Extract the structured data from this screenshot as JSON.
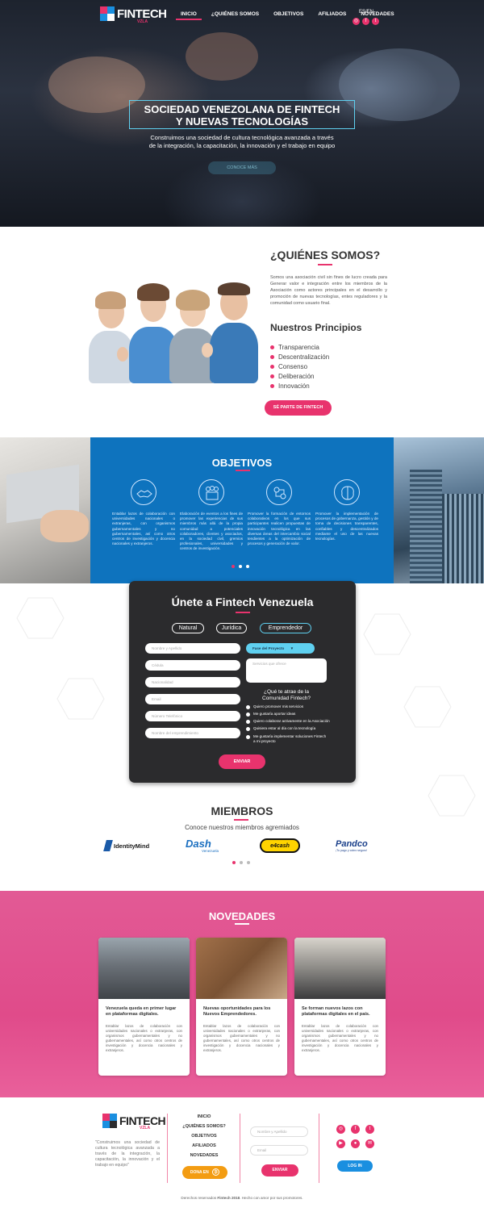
{
  "colors": {
    "accent": "#e8336d",
    "blue": "#0e73be",
    "cyan": "#5fd0f0",
    "dark": "#2b2b2d",
    "orange": "#f39c12",
    "login_blue": "#1a8fe0"
  },
  "brand": {
    "name": "FINTECH",
    "tag": "VZLA"
  },
  "nav": {
    "items": [
      "INICIO",
      "¿QUIÉNES SOMOS",
      "OBJETIVOS",
      "AFILIADOS",
      "NOVEDADES"
    ],
    "active": "INICIO",
    "lang": "ES/EN",
    "social": [
      "instagram-icon",
      "facebook-icon",
      "twitter-icon"
    ]
  },
  "hero": {
    "title_line1": "SOCIEDAD VENEZOLANA DE FINTECH",
    "title_line2": "Y NUEVAS TECNOLOGÍAS",
    "subtitle_line1": "Construimos una sociedad de cultura tecnológica avanzada a través",
    "subtitle_line2": "de la integración, la capacitación, la innovación y el trabajo en equipo",
    "button": "CONOCE MÁS"
  },
  "who": {
    "title": "¿QUIÉNES SOMOS?",
    "text": "Somos una asociación civil sin fines de lucro creada para Generar valor e integración entre los miembros de la Asociación como actores principales en el desarrollo y promoción de nuevas tecnologías, entes reguladores y la comunidad como usuario final.",
    "principles_title": "Nuestros Principios",
    "principles": [
      "Transparencia",
      "Descentralización",
      "Consenso",
      "Deliberación",
      "Innovación"
    ],
    "button": "SÉ PARTE DE FINTECH"
  },
  "objetivos": {
    "title": "OBJETIVOS",
    "items": [
      {
        "icon": "handshake-icon",
        "text": "Entablar lazos de colaboración con universidades nacionales o extranjeras, con organismos gubernamentales y no gubernamentales, así como otros centros de investigación y docencia nacionales y extranjeros."
      },
      {
        "icon": "people-icon",
        "text": "Elaboración de eventos a los fines de promover las experiencias de sus miembros más allá de la propia comunidad a potenciales colaboradores, clientes y asociados, en la sociedad civil, gremios profesionales, universidades y centros de investigación."
      },
      {
        "icon": "network-icon",
        "text": "Promover la formación de entornos colaborativos en los que sus participantes realicen propuestas de innovación tecnológica en las diversas áreas del intercambio social tendientes a la optimización de procesos y generación de valor."
      },
      {
        "icon": "brain-icon",
        "text": "Promover la implementación de procesos de gobernanza, gestión y de toma de decisiones transparentes, confiables y descentralizados mediante el uso de las nuevas tecnologías."
      }
    ]
  },
  "form": {
    "title": "Únete a Fintech Venezuela",
    "tabs": [
      "Natural",
      "Jurídica",
      "Emprendedor"
    ],
    "selected_tab": "Emprendedor",
    "fields": [
      "Nombre y Apellido",
      "Cédula",
      "Nacionalidad",
      "Email",
      "Número Telefónico",
      "Nombre del emprendimiento"
    ],
    "phase_select": "Fase del Proyecto",
    "services_placeholder": "Servicios que ofrece",
    "question_line1": "¿Qué te atrae de la",
    "question_line2": "Comunidad Fintech?",
    "options": [
      {
        "l1": "Quiero promover mis servicios",
        "l2": ""
      },
      {
        "l1": "Me gustaría aportar ideas",
        "l2": ""
      },
      {
        "l1": "Quiero colaborar activamente en la Asociación",
        "l2": ""
      },
      {
        "l1": "Quisiera estar al día con la tecnología",
        "l2": ""
      },
      {
        "l1": "Me gustaría implementar soluciones Fintech",
        "l2": "a mi proyecto"
      }
    ],
    "submit": "ENVIAR"
  },
  "members": {
    "title": "MIEMBROS",
    "subtitle": "Conoce nuestros miembros agremiados",
    "logos": [
      {
        "name": "IdentityMind"
      },
      {
        "name": "Dash",
        "sub": "Venezuela"
      },
      {
        "name": "e4cash"
      },
      {
        "name": "Pandco",
        "sub": "¡Tu pago y cobro seguro!"
      }
    ]
  },
  "news": {
    "title": "NOVEDADES",
    "cards": [
      {
        "title": "Venezuela queda en primer lugar en plataformas digitales.",
        "text": "Entablar lazos de colaboración con universidades nacionales o extranjeras, con organismos gubernamentales y no gubernamentales, así como otros centros de investigación y docencia nacionales y extranjeros."
      },
      {
        "title": "Nuevas oportunidades para los Nuevos Emprendedores.",
        "text": "Entablar lazos de colaboración con universidades nacionales o extranjeras, con organismos gubernamentales y no gubernamentales, así como otros centros de investigación y docencia nacionales y extranjeros."
      },
      {
        "title": "Se forman nuevos lazos con plataformas digitales en el país.",
        "text": "Entablar lazos de colaboración con universidades nacionales o extranjeras, con organismos gubernamentales y no gubernamentales, así como otros centros de investigación y docencia nacionales y extranjeros."
      }
    ]
  },
  "footer": {
    "quote": "\"Construimos una sociedad de cultura tecnológica avanzada a través de la integración, la capacitación, la innovación y el trabajo en equipo\"",
    "links": [
      "INICIO",
      "¿QUIÉNES SOMOS?",
      "OBJETIVOS",
      "AFILIADOS",
      "NOVEDADES"
    ],
    "donate": "DONA EN",
    "fields": [
      "Nombre y Apellido",
      "Email"
    ],
    "send": "ENVIAR",
    "login": "LOG IN",
    "social": [
      "instagram-icon",
      "facebook-icon",
      "twitter-icon",
      "youtube-icon",
      "github-icon",
      "mail-icon"
    ],
    "copyright_pre": "Derechos reservados ",
    "copyright_brand": "Fintech 2018",
    "copyright_post": ". Hecho con amor por sus promotores."
  }
}
